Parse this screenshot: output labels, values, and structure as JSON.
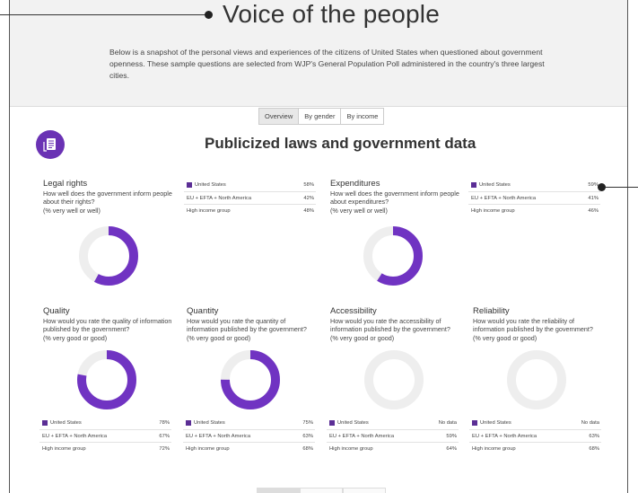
{
  "header": {
    "title": "Voice of the people",
    "intro": "Below is a snapshot of the personal views and experiences of the citizens of United States when questioned about government openness. These sample questions are selected from WJP's General Population Poll administered in the country's three largest cities."
  },
  "tabs": [
    {
      "label": "Overview",
      "active": true
    },
    {
      "label": "By gender",
      "active": false
    },
    {
      "label": "By income",
      "active": false
    }
  ],
  "section": {
    "title": "Publicized laws and government data",
    "icon": "document-icon"
  },
  "accent_color": "#6a32b4",
  "legend_rows": [
    "United States",
    "EU + EFTA + North America",
    "High income group"
  ],
  "chart_data": [
    {
      "type": "pie",
      "title": "Legal rights",
      "question": "How well does the government inform people about their rights?",
      "measure": "(% very well or well)",
      "values": [
        {
          "group": "United States",
          "value": "58%",
          "pct": 58
        },
        {
          "group": "EU + EFTA + North America",
          "value": "42%",
          "pct": 42
        },
        {
          "group": "High income group",
          "value": "48%",
          "pct": 48
        }
      ]
    },
    {
      "type": "pie",
      "title": "Expenditures",
      "question": "How well does the government inform people about expenditures?",
      "measure": "(% very well or well)",
      "values": [
        {
          "group": "United States",
          "value": "59%",
          "pct": 59
        },
        {
          "group": "EU + EFTA + North America",
          "value": "41%",
          "pct": 41
        },
        {
          "group": "High income group",
          "value": "46%",
          "pct": 46
        }
      ]
    },
    {
      "type": "pie",
      "title": "Quality",
      "question": "How would you rate the quality of information published by the government?",
      "measure": "(% very good or good)",
      "values": [
        {
          "group": "United States",
          "value": "78%",
          "pct": 78
        },
        {
          "group": "EU + EFTA + North America",
          "value": "67%",
          "pct": 67
        },
        {
          "group": "High income group",
          "value": "72%",
          "pct": 72
        }
      ]
    },
    {
      "type": "pie",
      "title": "Quantity",
      "question": "How would you rate the quantity of information published by the government?",
      "measure": "(% very good or good)",
      "values": [
        {
          "group": "United States",
          "value": "75%",
          "pct": 75
        },
        {
          "group": "EU + EFTA + North America",
          "value": "63%",
          "pct": 63
        },
        {
          "group": "High income group",
          "value": "68%",
          "pct": 68
        }
      ]
    },
    {
      "type": "pie",
      "title": "Accessibility",
      "question": "How would you rate the accessibility of information published by the government?",
      "measure": "(% very good or good)",
      "values": [
        {
          "group": "United States",
          "value": "No data",
          "pct": null
        },
        {
          "group": "EU + EFTA + North America",
          "value": "59%",
          "pct": 59
        },
        {
          "group": "High income group",
          "value": "64%",
          "pct": 64
        }
      ]
    },
    {
      "type": "pie",
      "title": "Reliability",
      "question": "How would you rate the reliability of information published by the government?",
      "measure": "(% very good or good)",
      "values": [
        {
          "group": "United States",
          "value": "No data",
          "pct": null
        },
        {
          "group": "EU + EFTA + North America",
          "value": "63%",
          "pct": 63
        },
        {
          "group": "High income group",
          "value": "68%",
          "pct": 68
        }
      ]
    }
  ]
}
